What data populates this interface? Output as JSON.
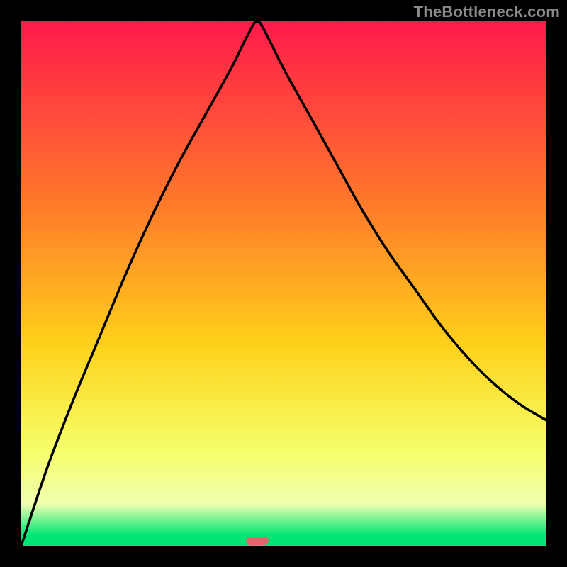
{
  "watermark": "TheBottleneck.com",
  "colors": {
    "top": "#ff1a4b",
    "upper_mid": "#ff7a2a",
    "mid": "#ffd21a",
    "lower_mid": "#f6ff6a",
    "pale": "#f0ffb0",
    "green": "#00e676",
    "marker": "#d86a6a",
    "curve": "#000000",
    "frame": "#000000"
  },
  "marker": {
    "x_pct": 45,
    "y_pct": 99
  },
  "chart_data": {
    "type": "line",
    "title": "",
    "xlabel": "",
    "ylabel": "",
    "xlim": [
      0,
      100
    ],
    "ylim": [
      0,
      100
    ],
    "series": [
      {
        "name": "curve",
        "x": [
          0,
          5,
          10,
          15,
          20,
          25,
          30,
          35,
          40,
          43,
          45,
          47,
          50,
          55,
          60,
          65,
          70,
          75,
          80,
          85,
          90,
          95,
          100
        ],
        "y": [
          0,
          15,
          28,
          40,
          52,
          63,
          73,
          82,
          91,
          97,
          100,
          97,
          91,
          82,
          73,
          64,
          56,
          49,
          42,
          36,
          31,
          27,
          24
        ]
      }
    ],
    "annotations": [
      {
        "type": "marker",
        "x": 45,
        "y": 100,
        "label": ""
      }
    ]
  }
}
